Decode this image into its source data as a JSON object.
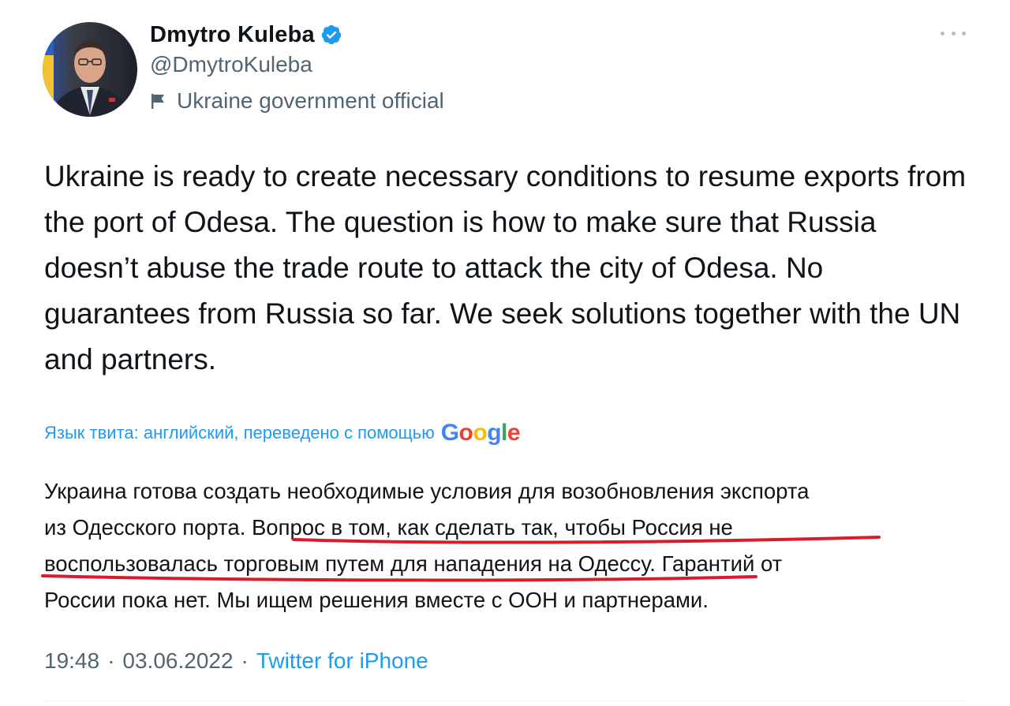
{
  "author": {
    "display_name": "Dmytro Kuleba",
    "handle": "@DmytroKuleba",
    "label": "Ukraine government official",
    "verified": true,
    "avatar_icon": "avatar-photo"
  },
  "tweet": {
    "text": "Ukraine is ready to create necessary conditions to resume exports from the port of Odesa. The question is how to make sure that Russia doesn’t abuse the trade route to attack the city of Odesa. No guarantees from Russia so far. We seek solutions together with the UN and partners."
  },
  "translation": {
    "note": "Язык твита: английский, переведено с помощью",
    "provider_letters": [
      "G",
      "o",
      "o",
      "g",
      "l",
      "e"
    ],
    "provider_colors": [
      "#4285f4",
      "#ea4335",
      "#fbbc05",
      "#4285f4",
      "#34a853",
      "#ea4335"
    ],
    "lines": [
      "Украина готова создать необходимые условия для возобновления экспорта",
      "из Одесского порта. Вопрос в том, как сделать так, чтобы Россия не",
      "воспользовалась торговым путем для нападения на Одессу. Гарантий от",
      "России пока нет. Мы ищем решения вместе с ООН и партнерами."
    ]
  },
  "meta": {
    "time": "19:48",
    "separator": "·",
    "date": "03.06.2022",
    "source": "Twitter for iPhone"
  },
  "colors": {
    "accent": "#1d9bf0",
    "secondary_text": "#536471",
    "underline": "#d91c2a"
  }
}
